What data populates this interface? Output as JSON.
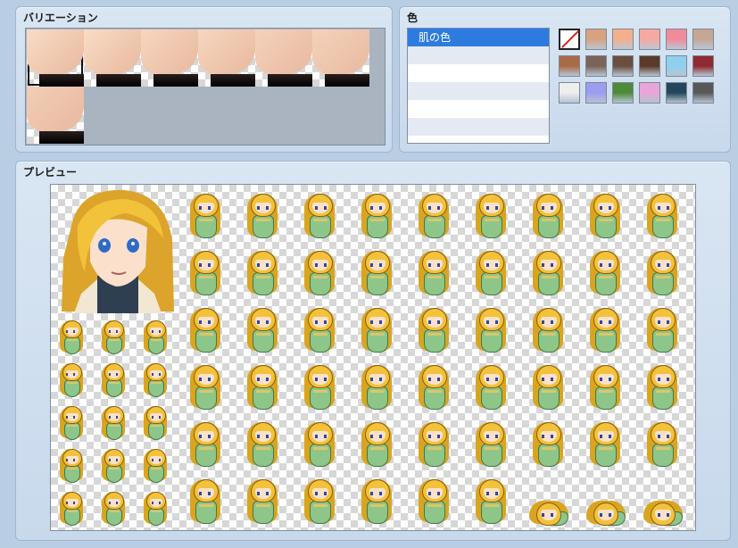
{
  "variation": {
    "title": "バリエーション",
    "selected_index": 0,
    "thumbnails": [
      {
        "skin": "#f9dcc5"
      },
      {
        "skin": "#f9dcc5"
      },
      {
        "skin": "#f7d6bf"
      },
      {
        "skin": "#f7d6bf"
      },
      {
        "skin": "#f5d2bb"
      },
      {
        "skin": "#f5d2bb"
      },
      {
        "skin": "#f2cdb6"
      }
    ]
  },
  "color": {
    "title": "色",
    "list": [
      "肌の色",
      "",
      "",
      "",
      "",
      "",
      ""
    ],
    "selected_index": 0,
    "swatches": [
      "none",
      "#d9a27f",
      "#f4b08c",
      "#f6a9a3",
      "#f28a9a",
      "#c6a796",
      "#a86b48",
      "#7a6458",
      "#6a4e3f",
      "#5a3a28",
      "#8fd0ee",
      "#8e2a30",
      "#eeeeee",
      "#9d9cf0",
      "#4d8a3a",
      "#eaa5d8",
      "#24465c",
      "#585858"
    ]
  },
  "preview": {
    "title": "プレビュー",
    "colors": {
      "hair": "#f2c23a",
      "robe": "#8ec68a",
      "skin": "#fbe1cb",
      "sweater": "#2f3f52"
    }
  }
}
